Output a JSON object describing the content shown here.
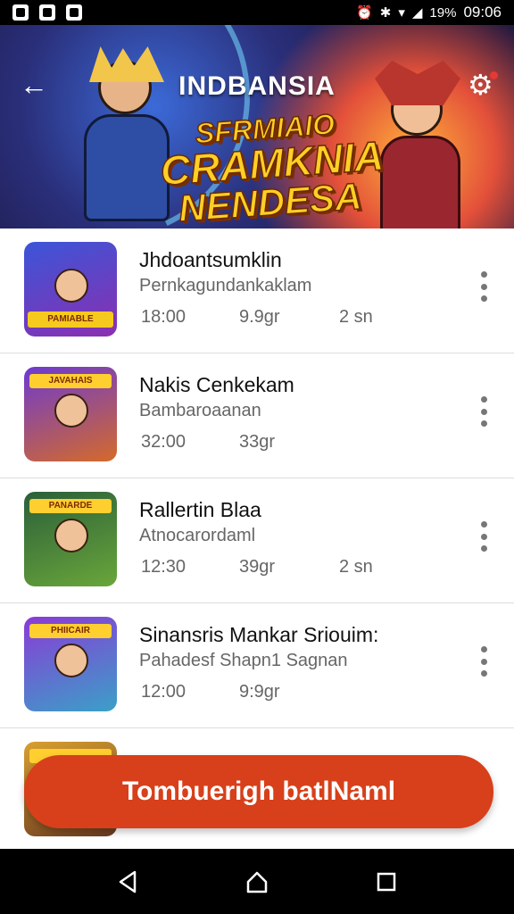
{
  "status_bar": {
    "battery": "19%",
    "time": "09:06"
  },
  "banner": {
    "title": "INDBANSIA",
    "logo_line1": "SFRMIAIO",
    "logo_line2": "CRAMKNIA",
    "logo_line3": "NENDESA",
    "back_icon": "arrow-left-icon",
    "settings_icon": "gear-icon"
  },
  "items": [
    {
      "title": "Jhdoantsumklin",
      "subtitle": "Pernkagundankaklam",
      "meta1": "18:00",
      "meta2": "9.9gr",
      "meta3": "2 sn",
      "thumb_text": "PAMIABLE"
    },
    {
      "title": "Nakis Cenkekam",
      "subtitle": "Bambaroaanan",
      "meta1": "32:00",
      "meta2": "33gr",
      "meta3": "",
      "thumb_text": "JAVAHAIS"
    },
    {
      "title": "Rallertin Blaa",
      "subtitle": "Atnocarordaml",
      "meta1": "12:30",
      "meta2": "39gr",
      "meta3": "2 sn",
      "thumb_text": "PANARDE"
    },
    {
      "title": "Sinansris Mankar Sriouim:",
      "subtitle": "Pahadesf Shapn1 Sagnan",
      "meta1": "12:00",
      "meta2": "9:9gr",
      "meta3": "",
      "thumb_text": "PHIICAIR"
    },
    {
      "title": "",
      "subtitle": "",
      "meta1": "",
      "meta2": "",
      "meta3": "",
      "thumb_text": ""
    }
  ],
  "primary_button": {
    "label": "Tombuerigh batlNaml"
  },
  "nav": {
    "back_icon": "triangle-back-icon",
    "home_icon": "home-icon",
    "recents_icon": "square-recents-icon"
  }
}
